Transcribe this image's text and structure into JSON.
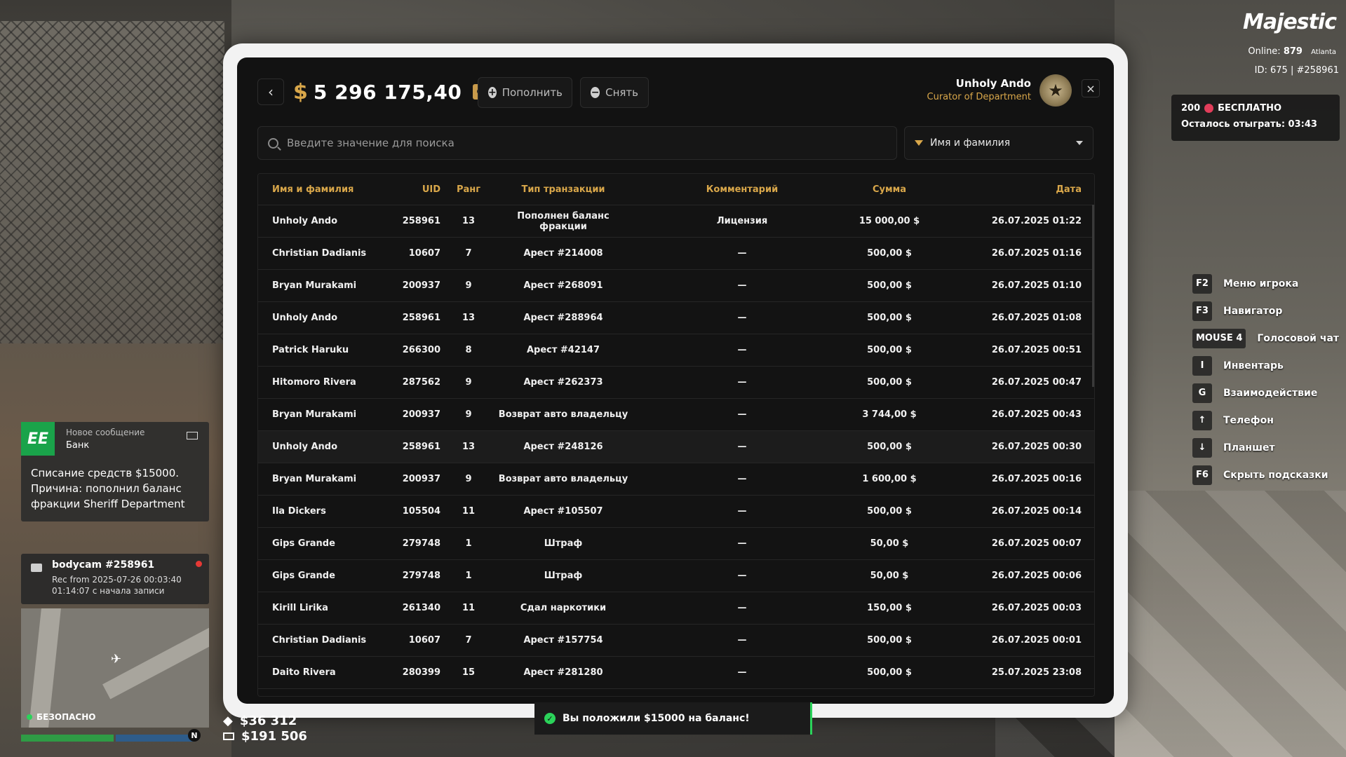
{
  "header": {
    "balance": "5 296 175,40",
    "currency_symbol": "$",
    "deposit_label": "Пополнить",
    "withdraw_label": "Снять",
    "user_name": "Unholy Ando",
    "user_role": "Curator of Department"
  },
  "search": {
    "placeholder": "Введите значение для поиска",
    "filter_value": "Имя и фамилия"
  },
  "table": {
    "columns": [
      "Имя и фамилия",
      "UID",
      "Ранг",
      "Тип транзакции",
      "Комментарий",
      "Сумма",
      "Дата"
    ],
    "rows": [
      [
        "Unholy Ando",
        "258961",
        "13",
        "Пополнен баланс фракции",
        "Лицензия",
        "15 000,00 $",
        "26.07.2025 01:22"
      ],
      [
        "Christian Dadianis",
        "10607",
        "7",
        "Арест #214008",
        "—",
        "500,00 $",
        "26.07.2025 01:16"
      ],
      [
        "Bryan Murakami",
        "200937",
        "9",
        "Арест #268091",
        "—",
        "500,00 $",
        "26.07.2025 01:10"
      ],
      [
        "Unholy Ando",
        "258961",
        "13",
        "Арест #288964",
        "—",
        "500,00 $",
        "26.07.2025 01:08"
      ],
      [
        "Patrick Haruku",
        "266300",
        "8",
        "Арест #42147",
        "—",
        "500,00 $",
        "26.07.2025 00:51"
      ],
      [
        "Hitomoro Rivera",
        "287562",
        "9",
        "Арест #262373",
        "—",
        "500,00 $",
        "26.07.2025 00:47"
      ],
      [
        "Bryan Murakami",
        "200937",
        "9",
        "Возврат авто владельцу",
        "—",
        "3 744,00 $",
        "26.07.2025 00:43"
      ],
      [
        "Unholy Ando",
        "258961",
        "13",
        "Арест #248126",
        "—",
        "500,00 $",
        "26.07.2025 00:30"
      ],
      [
        "Bryan Murakami",
        "200937",
        "9",
        "Возврат авто владельцу",
        "—",
        "1 600,00 $",
        "26.07.2025 00:16"
      ],
      [
        "Ila Dickers",
        "105504",
        "11",
        "Арест #105507",
        "—",
        "500,00 $",
        "26.07.2025 00:14"
      ],
      [
        "Gips Grande",
        "279748",
        "1",
        "Штраф",
        "—",
        "50,00 $",
        "26.07.2025 00:07"
      ],
      [
        "Gips Grande",
        "279748",
        "1",
        "Штраф",
        "—",
        "50,00 $",
        "26.07.2025 00:06"
      ],
      [
        "Kirill Lirika",
        "261340",
        "11",
        "Сдал наркотики",
        "—",
        "150,00 $",
        "26.07.2025 00:03"
      ],
      [
        "Christian Dadianis",
        "10607",
        "7",
        "Арест #157754",
        "—",
        "500,00 $",
        "26.07.2025 00:01"
      ],
      [
        "Daito Rivera",
        "280399",
        "15",
        "Арест #281280",
        "—",
        "500,00 $",
        "25.07.2025 23:08"
      ]
    ],
    "highlighted_row": 7
  },
  "hud": {
    "logo": "Majestic",
    "online_label": "Online:",
    "online_count": "879",
    "server_city": "Atlanta",
    "player_id": "ID: 675 | #258961",
    "bonus_count": "200",
    "bonus_label": "БЕСПЛАТНО",
    "bonus_remaining": "Осталось отыграть: 03:43",
    "hotkeys": [
      {
        "key": "F2",
        "label": "Меню игрока"
      },
      {
        "key": "F3",
        "label": "Навигатор"
      },
      {
        "key": "MOUSE 4",
        "label": "Голосовой чат"
      },
      {
        "key": "I",
        "label": "Инвентарь"
      },
      {
        "key": "G",
        "label": "Взаимодействие"
      },
      {
        "key": "↑",
        "label": "Телефон"
      },
      {
        "key": "↓",
        "label": "Планшет"
      },
      {
        "key": "F6",
        "label": "Скрыть подсказки"
      }
    ]
  },
  "notification": {
    "app_logo": "EE",
    "title": "Новое сообщение",
    "sender": "Банк",
    "body": "Списание средств $15000. Причина: пополнил баланс фракции Sheriff Department"
  },
  "bodycam": {
    "title": "bodycam #258961",
    "rec_from": "Rec from 2025-07-26 00:03:40",
    "elapsed": "01:14:07 с начала записи"
  },
  "status": {
    "safety": "БЕЗОПАСНО",
    "compass": "N",
    "cash": "$36 312",
    "bank": "$191 506"
  },
  "toast": {
    "message": "Вы положили $15000 на баланс!"
  },
  "colors": {
    "accent": "#d9a74a",
    "success": "#2bd35a",
    "panel_bg": "#121212"
  }
}
